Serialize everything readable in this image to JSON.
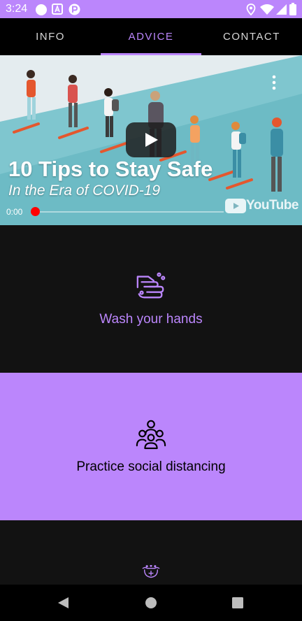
{
  "status_bar": {
    "time": "3:24",
    "bg_color": "#bb86fc",
    "left_icons": [
      "circle-notification-icon",
      "app-a-icon",
      "app-p-icon"
    ],
    "right_icons": [
      "location-icon",
      "wifi-icon",
      "signal-icon",
      "battery-icon"
    ]
  },
  "tabs": [
    {
      "label": "INFO",
      "active": false
    },
    {
      "label": "ADVICE",
      "active": true
    },
    {
      "label": "CONTACT",
      "active": false
    }
  ],
  "video": {
    "title": "10 Tips to Stay Safe",
    "subtitle": "In the Era of COVID-19",
    "current_time": "0:00",
    "progress": 0,
    "brand": "YouTube",
    "play_icon": "play-icon",
    "menu_icon": "more-vert-icon"
  },
  "advice_tiles": [
    {
      "label": "Wash your hands",
      "icon": "hand-wash-icon"
    },
    {
      "label": "Practice social distancing",
      "icon": "group-people-icon"
    },
    {
      "label": "",
      "icon": "mask-icon"
    }
  ],
  "colors": {
    "accent": "#bb86fc",
    "tile_dark": "#121212",
    "background": "#000000",
    "youtube_red": "#ff0000"
  },
  "nav_bar": {
    "buttons": [
      "back-icon",
      "home-icon",
      "recents-icon"
    ]
  }
}
